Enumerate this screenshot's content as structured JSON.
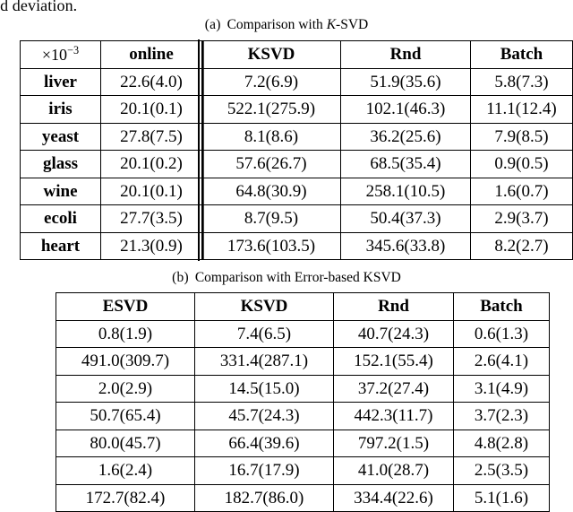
{
  "running_text": "rd deviation.",
  "tables": [
    {
      "id": "table-a",
      "caption_label": "(a)",
      "caption_text_pre": "Comparison with ",
      "caption_text_italic": "K",
      "caption_text_post": "-SVD",
      "caption_full": "(a)  Comparison with K-SVD",
      "unit_header": "×10",
      "unit_exponent": "−3",
      "columns": [
        "×10⁻³",
        "online",
        "KSVD",
        "Rnd",
        "Batch"
      ],
      "rows": [
        {
          "label": "liver",
          "cells": [
            "22.6(4.0)",
            "7.2(6.9)",
            "51.9(35.6)",
            "5.8(7.3)"
          ]
        },
        {
          "label": "iris",
          "cells": [
            "20.1(0.1)",
            "522.1(275.9)",
            "102.1(46.3)",
            "11.1(12.4)"
          ]
        },
        {
          "label": "yeast",
          "cells": [
            "27.8(7.5)",
            "8.1(8.6)",
            "36.2(25.6)",
            "7.9(8.5)"
          ]
        },
        {
          "label": "glass",
          "cells": [
            "20.1(0.2)",
            "57.6(26.7)",
            "68.5(35.4)",
            "0.9(0.5)"
          ]
        },
        {
          "label": "wine",
          "cells": [
            "20.1(0.1)",
            "64.8(30.9)",
            "258.1(10.5)",
            "1.6(0.7)"
          ]
        },
        {
          "label": "ecoli",
          "cells": [
            "27.7(3.5)",
            "8.7(9.5)",
            "50.4(37.3)",
            "2.9(3.7)"
          ]
        },
        {
          "label": "heart",
          "cells": [
            "21.3(0.9)",
            "173.6(103.5)",
            "345.6(33.8)",
            "8.2(2.7)"
          ]
        }
      ]
    },
    {
      "id": "table-b",
      "caption_label": "(b)",
      "caption_text": "Comparison with Error-based KSVD",
      "caption_full": "(b)  Comparison with Error-based KSVD",
      "columns": [
        "ESVD",
        "KSVD",
        "Rnd",
        "Batch"
      ],
      "rows": [
        {
          "cells": [
            "0.8(1.9)",
            "7.4(6.5)",
            "40.7(24.3)",
            "0.6(1.3)"
          ]
        },
        {
          "cells": [
            "491.0(309.7)",
            "331.4(287.1)",
            "152.1(55.4)",
            "2.6(4.1)"
          ]
        },
        {
          "cells": [
            "2.0(2.9)",
            "14.5(15.0)",
            "37.2(27.4)",
            "3.1(4.9)"
          ]
        },
        {
          "cells": [
            "50.7(65.4)",
            "45.7(24.3)",
            "442.3(11.7)",
            "3.7(2.3)"
          ]
        },
        {
          "cells": [
            "80.0(45.7)",
            "66.4(39.6)",
            "797.2(1.5)",
            "4.8(2.8)"
          ]
        },
        {
          "cells": [
            "1.6(2.4)",
            "16.7(17.9)",
            "41.0(28.7)",
            "2.5(3.5)"
          ]
        },
        {
          "cells": [
            "172.7(82.4)",
            "182.7(86.0)",
            "334.4(22.6)",
            "5.1(1.6)"
          ]
        }
      ]
    }
  ]
}
